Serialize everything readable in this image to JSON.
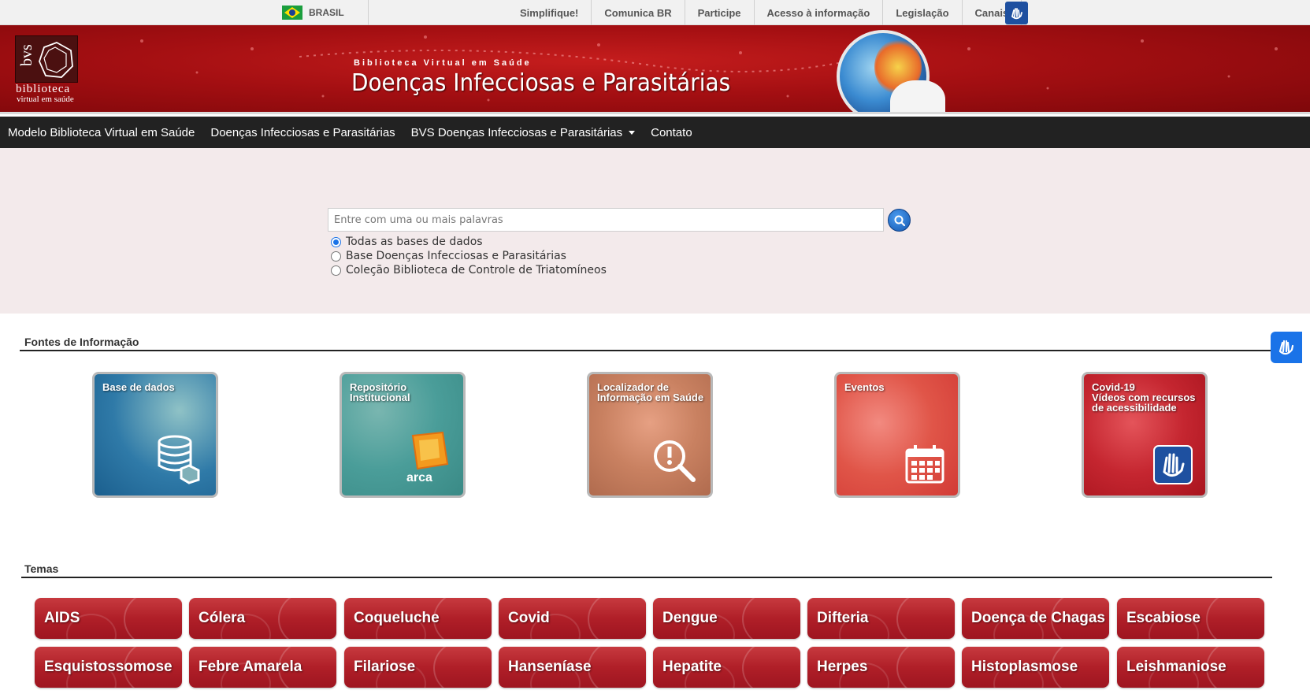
{
  "gov_bar": {
    "country": "BRASIL",
    "links": [
      "Simplifique!",
      "Comunica BR",
      "Participe",
      "Acesso à informação",
      "Legislação",
      "Canais"
    ]
  },
  "banner": {
    "logo_text": "biblioteca",
    "logo_subtext": "virtual em saúde",
    "subtitle": "Biblioteca Virtual em Saúde",
    "title": "Doenças Infecciosas e Parasitárias"
  },
  "nav": {
    "items": [
      "Modelo Biblioteca Virtual em Saúde",
      "Doenças Infecciosas e Parasitárias",
      "BVS Doenças Infecciosas e Parasitárias",
      "Contato"
    ]
  },
  "search": {
    "placeholder": "Entre com uma ou mais palavras",
    "options": [
      "Todas as bases de dados",
      "Base Doenças Infecciosas e Parasitárias",
      "Coleção Biblioteca de Controle de Triatomíneos"
    ],
    "selected": 0
  },
  "sources": {
    "heading": "Fontes de Informação",
    "tiles": [
      {
        "label1": "Base de dados",
        "label2": "",
        "label3": "",
        "icon": "database-icon"
      },
      {
        "label1": "Repositório",
        "label2": "Institucional",
        "label3": "",
        "icon": "arca-icon",
        "brand": "arca"
      },
      {
        "label1": "Localizador de",
        "label2": "Informação em Saúde",
        "label3": "",
        "icon": "magnifier-alert-icon"
      },
      {
        "label1": "Eventos",
        "label2": "",
        "label3": "",
        "icon": "calendar-icon"
      },
      {
        "label1": "Covid-19",
        "label2": "Vídeos com recursos",
        "label3": "de acessibilidade",
        "icon": "sign-language-icon"
      }
    ]
  },
  "themes": {
    "heading": "Temas",
    "row1": [
      "AIDS",
      "Cólera",
      "Coqueluche",
      "Covid",
      "Dengue",
      "Difteria",
      "Doença de Chagas",
      "Escabiose"
    ],
    "row2": [
      "Esquistossomose",
      "Febre Amarela",
      "Filariose",
      "Hanseníase",
      "Hepatite",
      "Herpes",
      "Histoplasmose",
      "Leishmaniose"
    ]
  },
  "colors": {
    "banner_red": "#a40f12",
    "nav_bg": "#222222",
    "search_bg": "#f3eaeb",
    "theme_red": "#b01f28",
    "accent_blue": "#1a73e8"
  }
}
